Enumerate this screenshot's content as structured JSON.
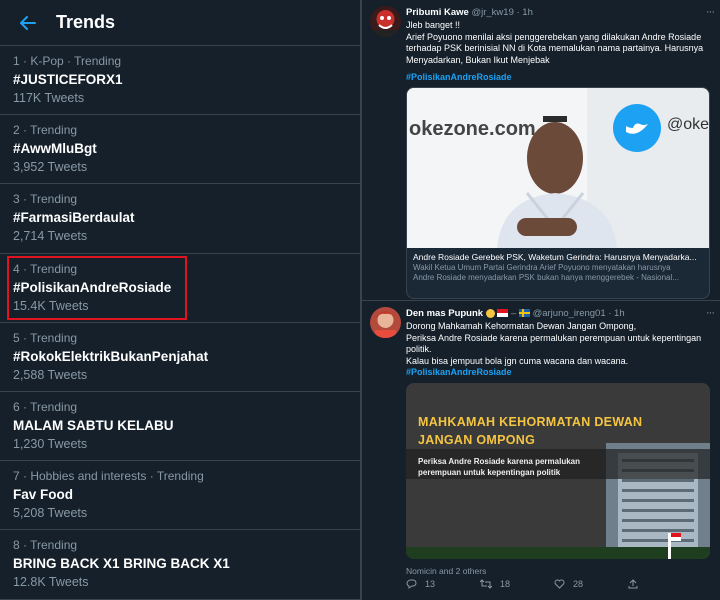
{
  "trends_panel": {
    "title": "Trends",
    "items": [
      {
        "meta": "1 · K-Pop · Trending",
        "tag": "#JUSTICEFORX1",
        "count": "117K Tweets"
      },
      {
        "meta": "2 · Trending",
        "tag": "#AwwMluBgt",
        "count": "3,952 Tweets"
      },
      {
        "meta": "3 · Trending",
        "tag": "#FarmasiBerdaulat",
        "count": "2,714 Tweets"
      },
      {
        "meta": "4 · Trending",
        "tag": "#PolisikanAndreRosiade",
        "count": "15.4K Tweets"
      },
      {
        "meta": "5 · Trending",
        "tag": "#RokokElektrikBukanPenjahat",
        "count": "2,588 Tweets"
      },
      {
        "meta": "6 · Trending",
        "tag": "MALAM SABTU KELABU",
        "count": "1,230 Tweets"
      },
      {
        "meta": "7 · Hobbies and interests · Trending",
        "tag": "Fav Food",
        "count": "5,208 Tweets"
      },
      {
        "meta": "8 · Trending",
        "tag": "BRING BACK X1 BRING BACK X1",
        "count": "12.8K Tweets"
      }
    ]
  },
  "tweet1": {
    "name": "Pribumi Kawe",
    "handle": "@jr_kw19 · 1h",
    "line1": "Jleb banget !!",
    "line2": "Arief Poyuono menilai aksi penggerebekan yang dilakukan Andre Rosiade",
    "line3": "terhadap PSK berinisial NN di Kota memalukan nama partainya. Harusnya",
    "line4": "Menyadarkan, Bukan Ikut Menjebak",
    "hashtag": "#PolisikanAndreRosiade",
    "card": {
      "brand": "okezone.com",
      "brand2": "@oke",
      "title": "Andre Rosiade Gerebek PSK, Waketum Gerindra: Harusnya Menyadarka...",
      "desc1": "Wakil Ketua Umum Partai Gerindra Arief Poyuono menyatakan harusnya",
      "desc2": "Andre Rosiade menyadarkan PSK bukan hanya menggerebek - Nasional..."
    }
  },
  "tweet2": {
    "name": "Den mas Pupunk",
    "handle": "@arjuno_ireng01 · 1h",
    "line1": "Dorong Mahkamah Kehormatan Dewan Jangan Ompong,",
    "line2": "Periksa Andre Rosiade karena permalukan perempuan untuk kepentingan",
    "line3": "politik.",
    "line4": "Kalau bisa jempuut bola jgn cuma wacana dan wacana.",
    "hashtag": "#PolisikanAndreRosiade",
    "image": {
      "headline1": "MAHKAMAH KEHORMATAN DEWAN",
      "headline2": "JANGAN OMPONG",
      "sub1": "Periksa Andre Rosiade karena permalukan",
      "sub2": "perempuan untuk kepentingan politik"
    },
    "people_tagged": "Nomicin and 2 others",
    "replies": "13",
    "retweets": "18",
    "likes": "28"
  },
  "colors": {
    "bg": "#15202b",
    "border": "#38444d",
    "muted": "#8899a6",
    "accent": "#1da1f2",
    "highlight": "#e0141e"
  }
}
